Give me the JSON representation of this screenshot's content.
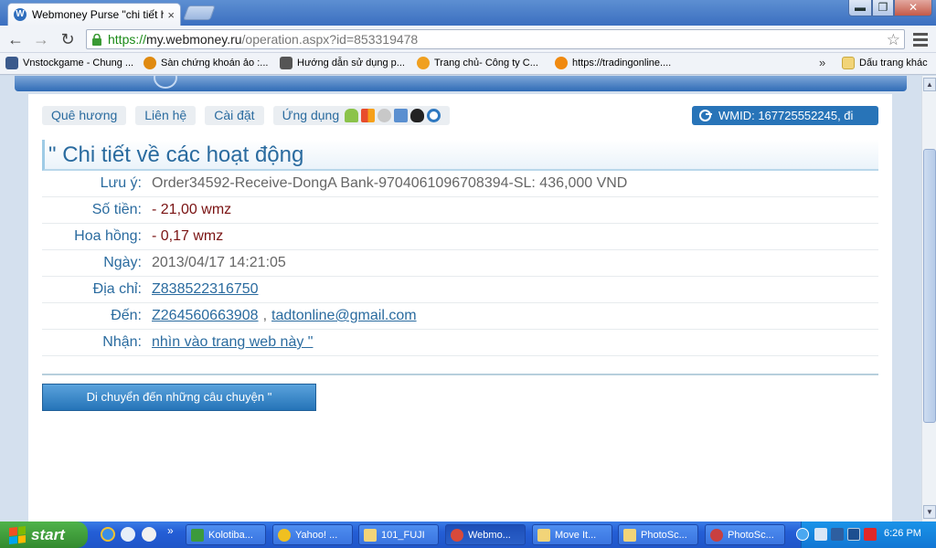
{
  "browser": {
    "tab_title": "Webmoney Purse \"chi tiết ho",
    "tab_close": "×",
    "url_scheme": "https://",
    "url_domain": "my.webmoney.ru",
    "url_path": "/operation.aspx?id=853319478",
    "bookmarks": [
      {
        "label": "Vnstockgame - Chung ...",
        "icon": "vnstock-icon",
        "color": "#3b5a8c"
      },
      {
        "label": "Sàn chứng khoán ảo :...",
        "icon": "radiation-icon",
        "color": "#e08a10"
      },
      {
        "label": "Hướng dẫn sử dụng p...",
        "icon": "video-icon",
        "color": "#555555"
      },
      {
        "label": "Trang chủ- Công ty C...",
        "icon": "firefox-icon",
        "color": "#f0a020"
      },
      {
        "label": "https://tradingonline....",
        "icon": "firefox-icon",
        "color": "#f08a10"
      }
    ],
    "bookmarks_overflow": "»",
    "other_bookmarks": "Dấu trang khác"
  },
  "menu": {
    "home": "Quê hương",
    "contact": "Liên hệ",
    "settings": "Cài đặt",
    "apps": "Ứng dụng"
  },
  "wmid_label": "WMID: 167725552245, đi",
  "section_title": "\" Chi tiết về các hoạt động",
  "details": {
    "note_label": "Lưu ý:",
    "note_value": "Order34592-Receive-DongA Bank-9704061096708394-SL: 436,000 VND",
    "amount_label": "Số tiền:",
    "amount_value": "- 21,00 wmz",
    "commission_label": "Hoa hồng:",
    "commission_value": "- 0,17 wmz",
    "date_label": "Ngày:",
    "date_value": "2013/04/17 14:21:05",
    "address_label": "Địa chỉ:",
    "address_value": "Z838522316750",
    "to_label": "Đến:",
    "to_purse": "Z264560663908",
    "to_separator": ",",
    "to_email": "tadtonline@gmail.com",
    "receive_label": "Nhận:",
    "receive_value": "nhìn vào trang web này \""
  },
  "history_button": "Di chuyển đến những câu chuyện \"",
  "taskbar": {
    "start": "start",
    "quicklaunch_more": "»",
    "tasks": [
      {
        "label": "Kolotiba...",
        "icon": "spreadsheet-icon",
        "color": "#3c9a3c"
      },
      {
        "label": "Yahoo! ...",
        "icon": "yahoo-messenger-icon",
        "color": "#f0c020"
      },
      {
        "label": "101_FUJI",
        "icon": "folder-icon",
        "color": "#f2d478"
      },
      {
        "label": "Webmo...",
        "icon": "chrome-icon",
        "color": "#d84a3a",
        "active": true
      },
      {
        "label": "Move It...",
        "icon": "folder-icon",
        "color": "#f2d478"
      },
      {
        "label": "PhotoSc...",
        "icon": "folder-icon",
        "color": "#f2d478"
      },
      {
        "label": "PhotoSc...",
        "icon": "photoscape-icon",
        "color": "#c84040"
      }
    ],
    "clock": "6:26 PM"
  }
}
